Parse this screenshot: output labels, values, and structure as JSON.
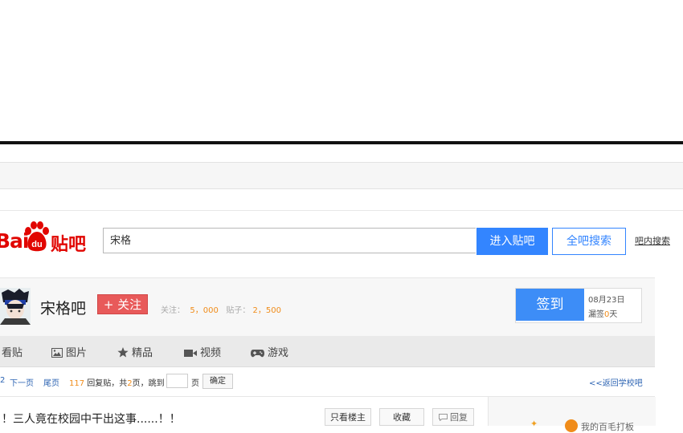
{
  "logo": {
    "text_bai": "Bai",
    "text_du": "du",
    "text_tieba": "贴吧"
  },
  "search": {
    "value": "宋格",
    "enter_label": "进入贴吧",
    "all_label": "全吧搜索",
    "inner_label": "吧内搜索"
  },
  "forum": {
    "name": "宋格吧",
    "follow_label": "+ 关注",
    "follow_prefix": "关注：",
    "follow_count": "5，000",
    "posts_prefix": "贴子：",
    "posts_count": "2，500"
  },
  "signin": {
    "button": "签到",
    "date": "08月23日",
    "miss_prefix": "漏签",
    "miss_count": "0",
    "miss_suffix": "天"
  },
  "tabs": [
    {
      "label": "看贴",
      "icon": "post-icon"
    },
    {
      "label": "图片",
      "icon": "image-icon"
    },
    {
      "label": "精品",
      "icon": "star-icon"
    },
    {
      "label": "视频",
      "icon": "video-icon"
    },
    {
      "label": "游戏",
      "icon": "gamepad-icon"
    }
  ],
  "pager": {
    "prev_fragment": "2",
    "next": "下一页",
    "last": "尾页",
    "reply_count": "117",
    "reply_text": "回复贴，共",
    "pages": "2",
    "pages_text": "页，跳到",
    "page_unit": "页",
    "go": "确定",
    "back": "<<返回学校吧"
  },
  "post": {
    "title": "！三人竟在校园中干出这事......！！",
    "only_owner": "只看楼主",
    "collect": "收藏",
    "reply": "回复"
  },
  "side": {
    "text": "我的百毛打板"
  },
  "colors": {
    "brand_red": "#e10601",
    "primary_blue": "#3385ff",
    "accent_orange": "#f08c1a",
    "link_blue": "#2d64b3"
  }
}
